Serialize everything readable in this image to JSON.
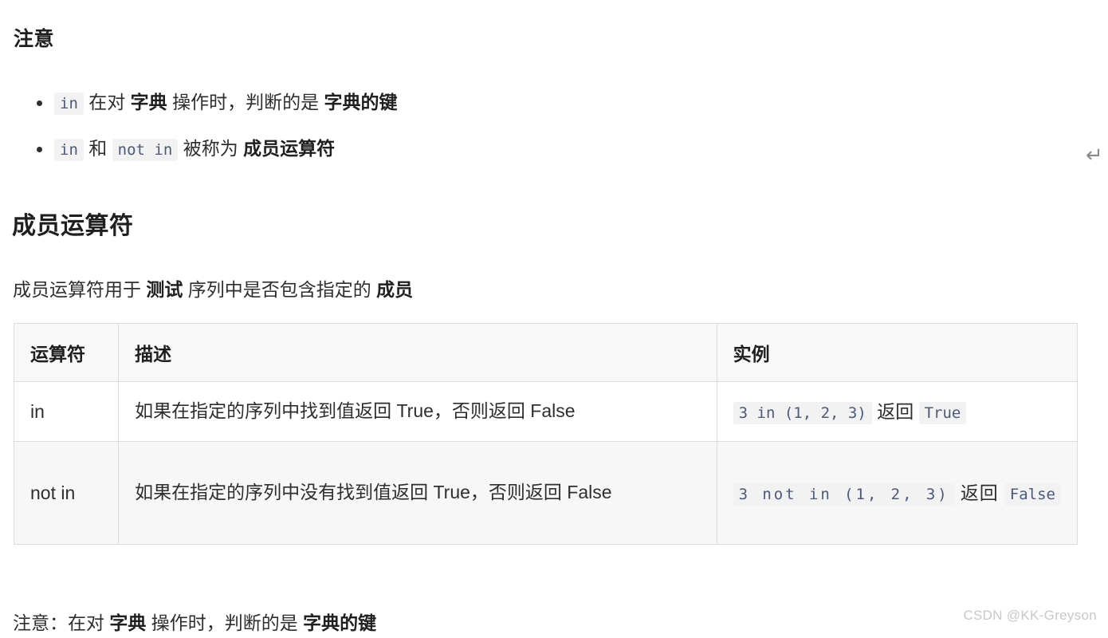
{
  "headings": {
    "note": "注意",
    "section": "成员运算符"
  },
  "bullets": [
    {
      "code1": "in",
      "text1": "在对",
      "strong1": "字典",
      "text2": "操作时，判断的是",
      "strong2": "字典的键"
    },
    {
      "code1": "in",
      "text1": "和",
      "code2": "not in",
      "text2": "被称为",
      "strong1": "成员运算符"
    }
  ],
  "intro": {
    "part1": "成员运算符用于",
    "strong1": "测试",
    "part2": "序列中是否包含指定的",
    "strong2": "成员"
  },
  "table": {
    "headers": [
      "运算符",
      "描述",
      "实例"
    ],
    "rows": [
      {
        "operator": "in",
        "description": "如果在指定的序列中找到值返回 True，否则返回 False",
        "example_code": "3 in (1, 2, 3)",
        "example_mid": "返回",
        "example_result": "True"
      },
      {
        "operator": "not in",
        "description": "如果在指定的序列中没有找到值返回 True，否则返回 False",
        "example_code": "3 not in (1, 2, 3)",
        "example_mid": "返回",
        "example_result": "False"
      }
    ]
  },
  "footnote": {
    "part1": "注意：在对",
    "strong1": "字典",
    "part2": "操作时，判断的是",
    "strong2": "字典的键"
  },
  "misc": {
    "return_arrow": "↵",
    "watermark": "CSDN @KK-Greyson"
  },
  "colors": {
    "text": "#2e2e2e",
    "heading": "#1f1f1f",
    "code_bg": "#f2f2f2",
    "code_fg": "#4a5a7b",
    "table_border": "#dcdcdc",
    "table_header_bg": "#f8f8f8",
    "row_alt_bg": "#f7f7f7",
    "watermark": "#c8c8c8"
  }
}
